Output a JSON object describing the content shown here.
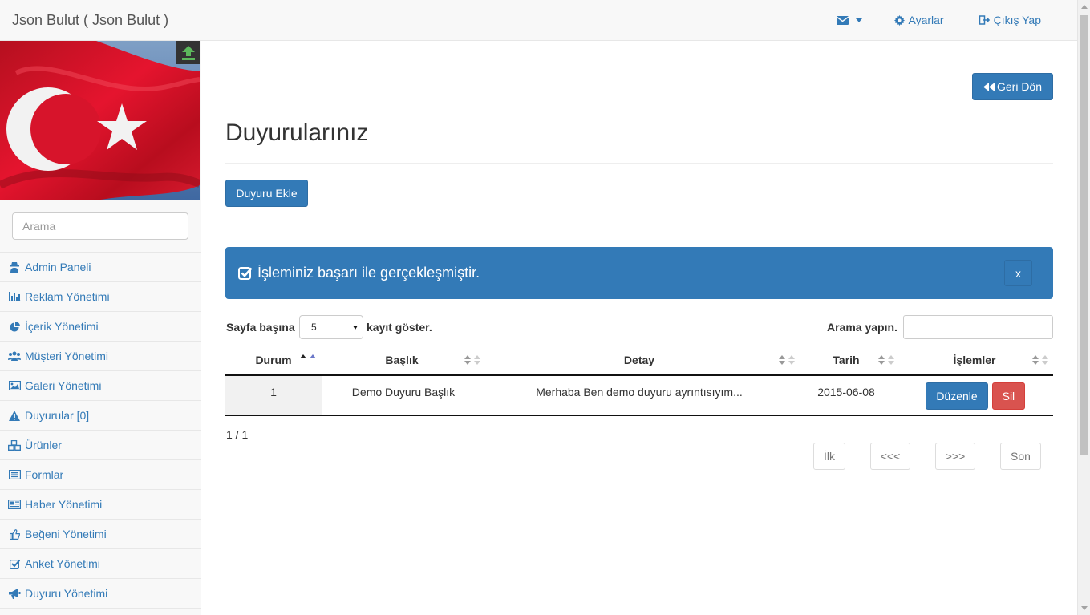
{
  "navbar": {
    "brand": "Json Bulut ( Json Bulut )",
    "settings_label": "Ayarlar",
    "logout_label": "Çıkış Yap"
  },
  "sidebar": {
    "search_placeholder": "Arama",
    "items": [
      {
        "label": "Admin Paneli",
        "icon": "user-secret-icon"
      },
      {
        "label": "Reklam Yönetimi",
        "icon": "bar-chart-icon"
      },
      {
        "label": "İçerik Yönetimi",
        "icon": "pie-chart-icon"
      },
      {
        "label": "Müşteri Yönetimi",
        "icon": "users-icon"
      },
      {
        "label": "Galeri Yönetimi",
        "icon": "picture-icon"
      },
      {
        "label": "Duyurular [0]",
        "icon": "warning-icon"
      },
      {
        "label": "Ürünler",
        "icon": "cubes-icon"
      },
      {
        "label": "Formlar",
        "icon": "list-alt-icon"
      },
      {
        "label": "Haber Yönetimi",
        "icon": "newspaper-icon"
      },
      {
        "label": "Beğeni Yönetimi",
        "icon": "thumbs-up-icon"
      },
      {
        "label": "Anket Yönetimi",
        "icon": "check-square-icon"
      },
      {
        "label": "Duyuru Yönetimi",
        "icon": "bullhorn-icon"
      }
    ]
  },
  "main": {
    "back_label": "Geri Dön",
    "title": "Duyurularınız",
    "add_label": "Duyuru Ekle",
    "alert_text": "İşleminiz başarı ile gerçekleşmiştir.",
    "alert_close": "x",
    "length_label": "Sayfa başına",
    "length_value": "5",
    "length_suffix": "kayıt göster.",
    "search_label": "Arama yapın.",
    "columns": [
      "Durum",
      "Başlık",
      "Detay",
      "Tarih",
      "İşlemler"
    ],
    "rows": [
      {
        "durum": "1",
        "baslik": "Demo Duyuru Başlık",
        "detay": "Merhaba Ben demo duyuru ayrıntısıyım...",
        "tarih": "2015-06-08",
        "edit": "Düzenle",
        "delete": "Sil"
      }
    ],
    "info": "1 / 1",
    "pager": [
      "İlk",
      "<<<",
      ">>>",
      "Son"
    ]
  },
  "colors": {
    "primary": "#337ab7",
    "danger": "#d9534f",
    "upload_arrow": "#5cb85c"
  }
}
